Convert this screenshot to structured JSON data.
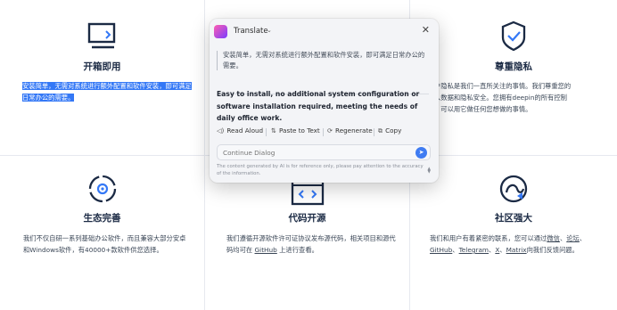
{
  "features": [
    {
      "title": "开箱即用",
      "desc": "安装简单，无需对系统进行额外配置和软件安装，即可满足日常办公的需要。",
      "icon": "monitor-icon"
    },
    {
      "title": "尊重隐私",
      "desc_lines": [
        "户隐私是我们一直所关注的事情。我们尊重您的",
        "人数据和隐私安全。您拥有deepin的所有控制",
        "，可以用它做任何您想做的事情。"
      ],
      "icon": "shield-check-icon"
    },
    {
      "title": "生态完善",
      "desc": "我们不仅自研一系列基础办公软件，而且兼容大部分安卓和Windows软件，有40000+款软件供您选择。",
      "icon": "ecosystem-icon"
    },
    {
      "title": "代码开源",
      "desc_pre": "我们遵循开源软件许可证协议发布源代码，相关项目和源代码均可在 ",
      "desc_link": "GitHub",
      "desc_post": " 上进行查看。",
      "icon": "code-window-icon"
    },
    {
      "title": "社区强大",
      "desc_pre": "我们和用户有着紧密的联系，您可以通过",
      "links": [
        "微信",
        "论坛",
        "GitHub",
        "Telegram",
        "X",
        "Matrix"
      ],
      "desc_post": "向我们反馈问题。",
      "icon": "community-icon"
    }
  ],
  "popup": {
    "title": "Translate",
    "source_text": "安装简单，无需对系统进行额外配置和软件安装，即可满足日常办公的需要。",
    "translation": "Easy to install, no additional system configuration or software installation required, meeting the needs of daily office work.",
    "actions": {
      "read_aloud": "Read Aloud",
      "paste_to_text": "Paste to Text",
      "regenerate": "Regenerate",
      "copy": "Copy"
    },
    "dialog_placeholder": "Continue Dialog",
    "disclaimer": "The content generated by AI is for reference only, please pay attention to the accuracy of the information."
  },
  "colors": {
    "accent": "#3478f6",
    "icon": "#1b2a44"
  }
}
